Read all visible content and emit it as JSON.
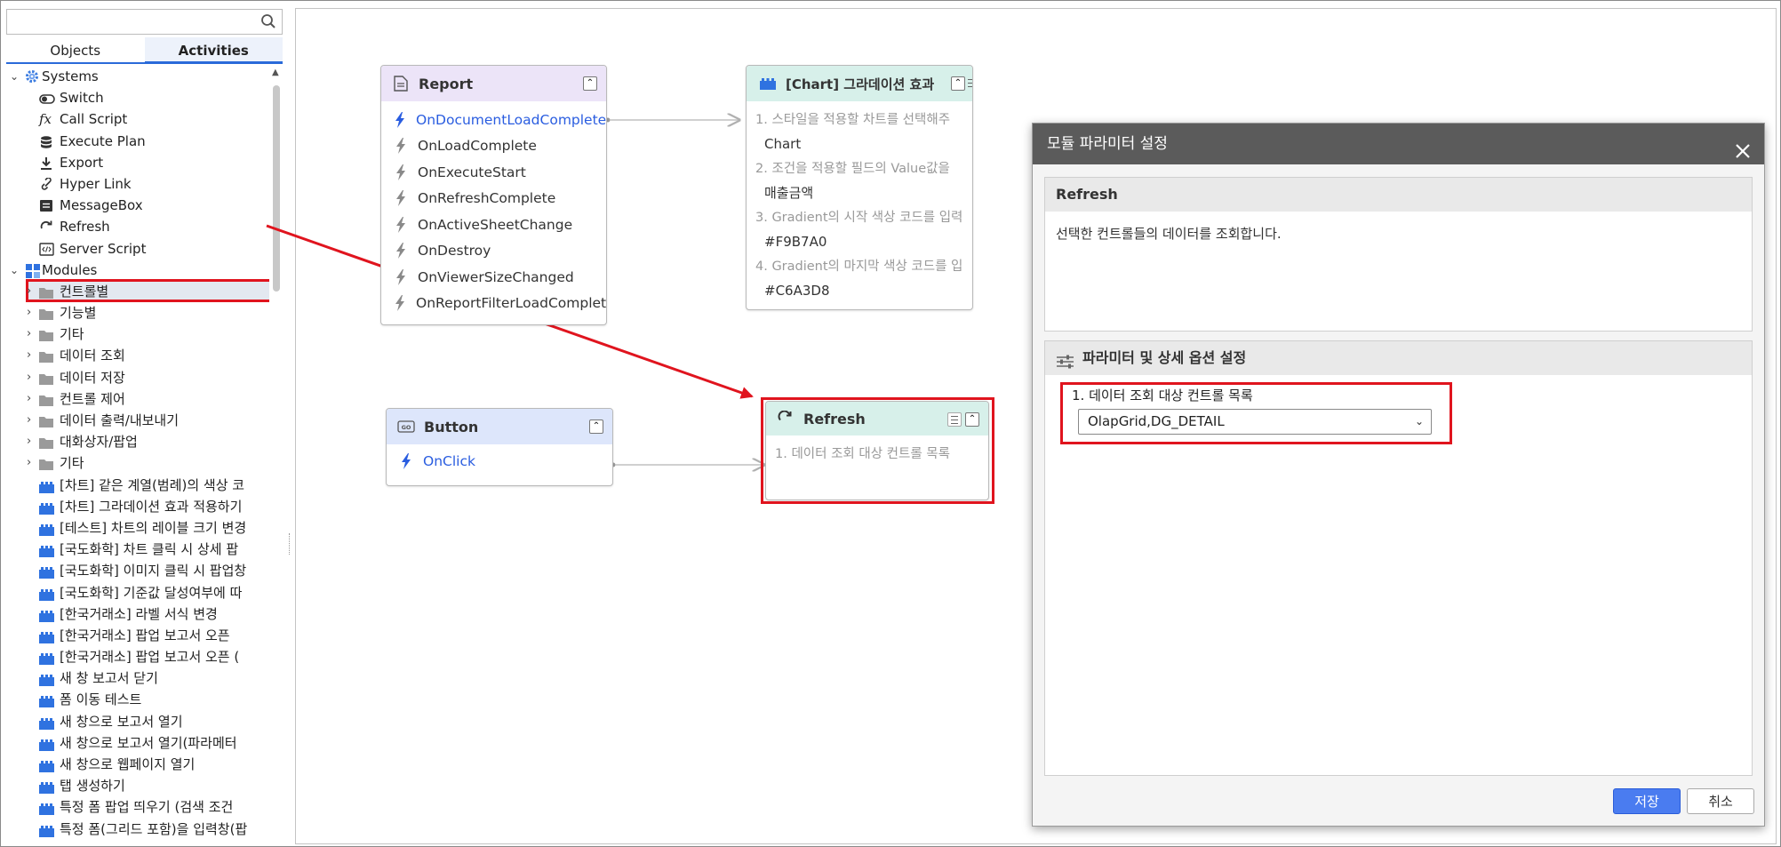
{
  "sidebar": {
    "search": {
      "placeholder": "",
      "value": ""
    },
    "tabs": [
      {
        "label": "Objects"
      },
      {
        "label": "Activities"
      }
    ],
    "systems": {
      "label": "Systems",
      "items": [
        {
          "label": "Switch",
          "icon": "toggle-icon"
        },
        {
          "label": "Call Script",
          "icon": "fx-icon"
        },
        {
          "label": "Execute Plan",
          "icon": "database-icon"
        },
        {
          "label": "Export",
          "icon": "download-icon"
        },
        {
          "label": "Hyper Link",
          "icon": "link-icon"
        },
        {
          "label": "MessageBox",
          "icon": "message-icon"
        },
        {
          "label": "Refresh",
          "icon": "refresh-icon",
          "selected": true
        },
        {
          "label": "Server Script",
          "icon": "code-icon"
        }
      ]
    },
    "modules": {
      "label": "Modules",
      "folders": [
        {
          "label": "컨트롤별"
        },
        {
          "label": "기능별"
        },
        {
          "label": "기타"
        },
        {
          "label": "데이터 조회"
        },
        {
          "label": "데이터 저장"
        },
        {
          "label": "컨트롤 제어"
        },
        {
          "label": "데이터 출력/내보내기"
        },
        {
          "label": "대화상자/팝업"
        },
        {
          "label": "기타"
        }
      ],
      "items": [
        {
          "label": "[차트] 같은 계열(범례)의 색상 코"
        },
        {
          "label": "[차트] 그라데이션 효과 적용하기"
        },
        {
          "label": "[테스트] 차트의 레이블 크기 변경"
        },
        {
          "label": "[국도화학] 차트 클릭 시 상세 팝"
        },
        {
          "label": "[국도화학] 이미지 클릭 시 팝업창"
        },
        {
          "label": "[국도화학] 기준값 달성여부에 따"
        },
        {
          "label": "[한국거래소] 라벨 서식 변경"
        },
        {
          "label": "[한국거래소] 팝업 보고서 오픈"
        },
        {
          "label": "[한국거래소] 팝업 보고서 오픈 ("
        },
        {
          "label": "새 창 보고서 닫기"
        },
        {
          "label": "폼 이동 테스트"
        },
        {
          "label": "새 창으로 보고서 열기"
        },
        {
          "label": "새 창으로 보고서 열기(파라메터"
        },
        {
          "label": "새 창으로 웹페이지 열기"
        },
        {
          "label": "탭 생성하기"
        },
        {
          "label": "특정 폼 팝업 띄우기 (검색 조건"
        },
        {
          "label": "특정 폼(그리드 포함)을 입력창(팝"
        }
      ]
    }
  },
  "canvas": {
    "report_node": {
      "title": "Report",
      "events": [
        "OnDocumentLoadComplete",
        "OnLoadComplete",
        "OnExecuteStart",
        "OnRefreshComplete",
        "OnActiveSheetChange",
        "OnDestroy",
        "OnViewerSizeChanged",
        "OnReportFilterLoadComplet"
      ]
    },
    "chart_node": {
      "title": "[Chart] 그라데이션 효과",
      "params": [
        {
          "q": "1. 스타일을 적용할 차트를 선택해주",
          "v": "Chart"
        },
        {
          "q": "2. 조건을 적용할 필드의 Value값을",
          "v": "매출금액"
        },
        {
          "q": "3. Gradient의 시작 색상 코드를 입력",
          "v": "#F9B7A0"
        },
        {
          "q": "4. Gradient의 마지막 색상 코드를 입",
          "v": "#C6A3D8"
        }
      ]
    },
    "button_node": {
      "title": "Button",
      "events": [
        "OnClick"
      ]
    },
    "refresh_node": {
      "title": "Refresh",
      "params": [
        {
          "q": "1. 데이터 조회 대상 컨트롤 목록"
        }
      ]
    }
  },
  "dialog": {
    "title": "모듈 파라미터 설정",
    "module_name": "Refresh",
    "description": "선택한 컨트롤들의 데이터를 조회합니다.",
    "param_section_title": "파라미터 및 상세 옵션 설정",
    "param_label": "1. 데이터 조회 대상 컨트롤 목록",
    "param_value": "OlapGrid,DG_DETAIL",
    "save_label": "저장",
    "cancel_label": "취소"
  },
  "colors": {
    "accent": "#2a6ad9",
    "highlight_red": "#e0141e",
    "report_header": "#ece4f8",
    "chart_header": "#d7f0ea",
    "button_header": "#dde6fb",
    "refresh_header": "#d7f0ea",
    "dialog_title_bg": "#5b5b5b",
    "primary_button": "#4a7cf0"
  }
}
